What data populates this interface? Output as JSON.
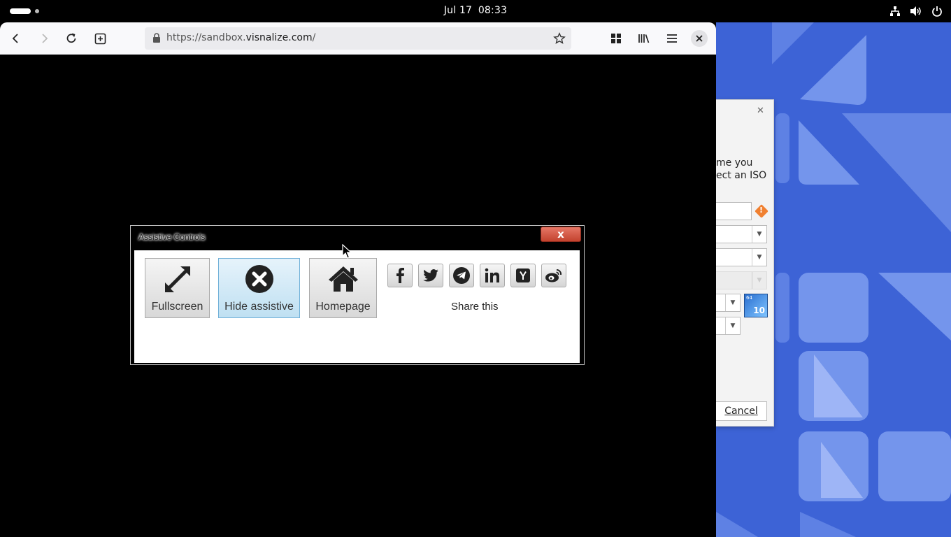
{
  "topbar": {
    "date": "Jul 17",
    "time": "08:33",
    "tray_icons": [
      "network-icon",
      "volume-icon",
      "power-icon"
    ]
  },
  "browser": {
    "url_prefix": "https://sandbox.",
    "url_domain": "visnalize.com",
    "url_suffix": "/",
    "nav_icons": [
      "back-icon",
      "forward-icon",
      "reload-icon",
      "new-tab-icon"
    ],
    "toolbar_icons": [
      "extensions-icon",
      "library-icon",
      "menu-icon",
      "close-icon"
    ]
  },
  "assistive": {
    "title": "Assistive Controls",
    "close_label": "x",
    "buttons": [
      {
        "label": "Fullscreen",
        "icon": "expand-arrows-icon"
      },
      {
        "label": "Hide assistive",
        "icon": "close-circle-icon"
      },
      {
        "label": "Homepage",
        "icon": "home-icon"
      }
    ],
    "share_icons": [
      "facebook-icon",
      "twitter-icon",
      "telegram-icon",
      "linkedin-icon",
      "hackernews-icon",
      "weibo-icon"
    ],
    "share_label": "Share this"
  },
  "background_dialog": {
    "text_line1": "me you",
    "text_line2": "ect an ISO",
    "cancel_label": "Cancel",
    "warning_glyph": "!",
    "badge_top": "64",
    "badge_bottom": "10"
  },
  "colors": {
    "wallpaper": "#3d63d6",
    "close_button": "#d0503c",
    "hide_button": "#bfe0f2"
  }
}
